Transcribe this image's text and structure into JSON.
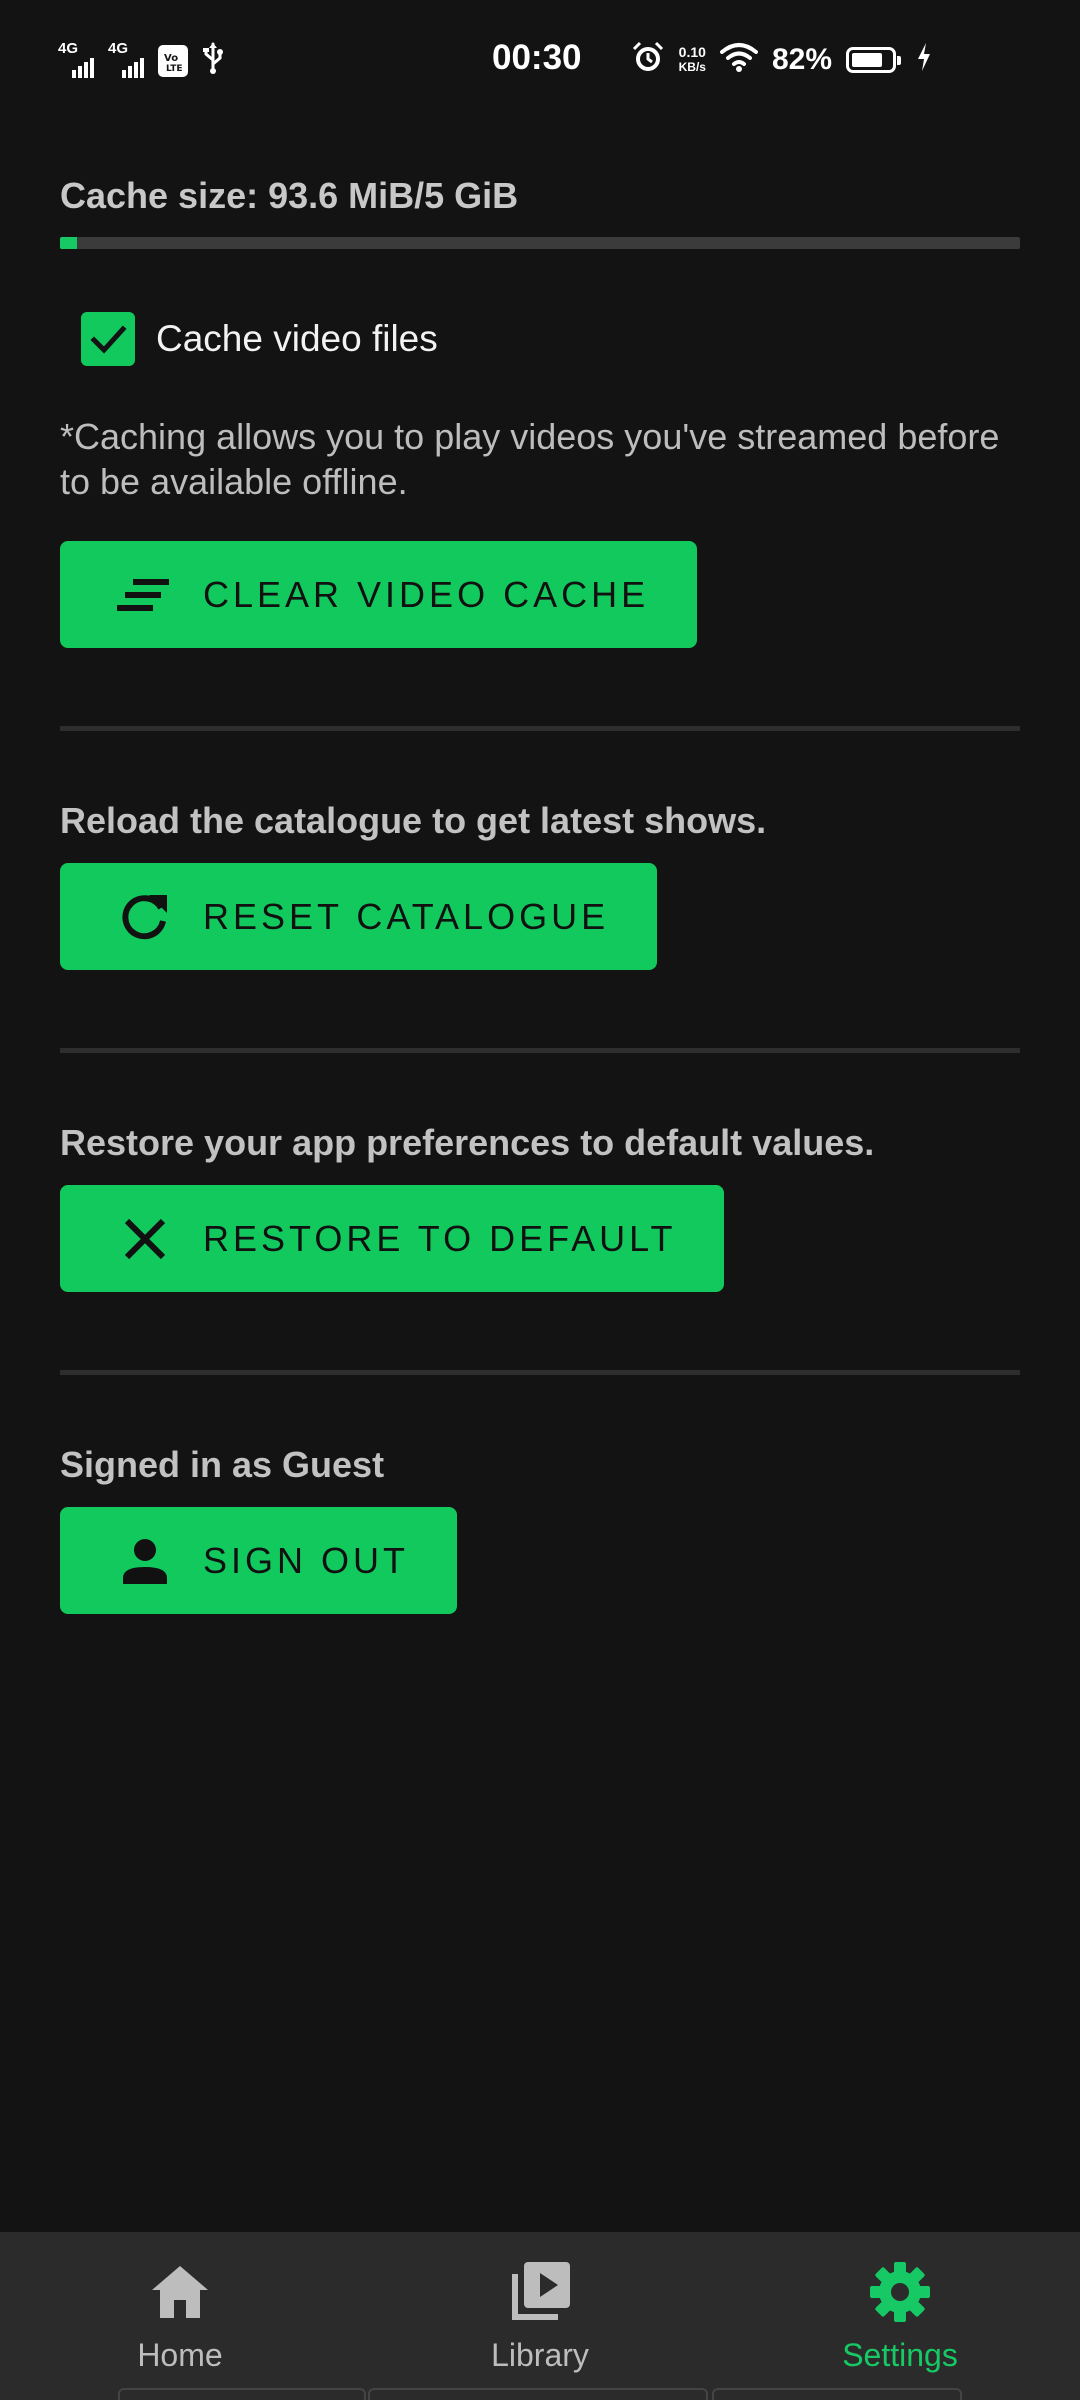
{
  "status_bar": {
    "network_1": "4G",
    "network_2": "4G",
    "sim_label": "VoLTE",
    "time": "00:30",
    "speed_value": "0.10",
    "speed_unit": "KB/s",
    "battery_percent_text": "82%",
    "battery_level": 0.82
  },
  "cache": {
    "size_label": "Cache size: 93.6 MiB/5 GiB",
    "usage_fraction": 0.018,
    "checkbox_label": "Cache video files",
    "checkbox_checked": true,
    "note": "*Caching allows you to play videos you've streamed before to be available offline.",
    "clear_button_label": "CLEAR VIDEO CACHE"
  },
  "catalogue": {
    "description": "Reload the catalogue to get latest shows.",
    "reset_button_label": "RESET CATALOGUE"
  },
  "preferences": {
    "description": "Restore your app preferences to default values.",
    "restore_button_label": "RESTORE TO DEFAULT"
  },
  "account": {
    "signed_in_text": "Signed in as Guest",
    "sign_out_button_label": "SIGN OUT"
  },
  "bottom_nav": {
    "items": [
      {
        "label": "Home",
        "icon": "home-icon",
        "active": false
      },
      {
        "label": "Library",
        "icon": "video-library-icon",
        "active": false
      },
      {
        "label": "Settings",
        "icon": "gear-icon",
        "active": true
      }
    ]
  },
  "colors": {
    "background": "#131313",
    "accent": "#12c95e",
    "nav_background": "#2b2b2b"
  }
}
